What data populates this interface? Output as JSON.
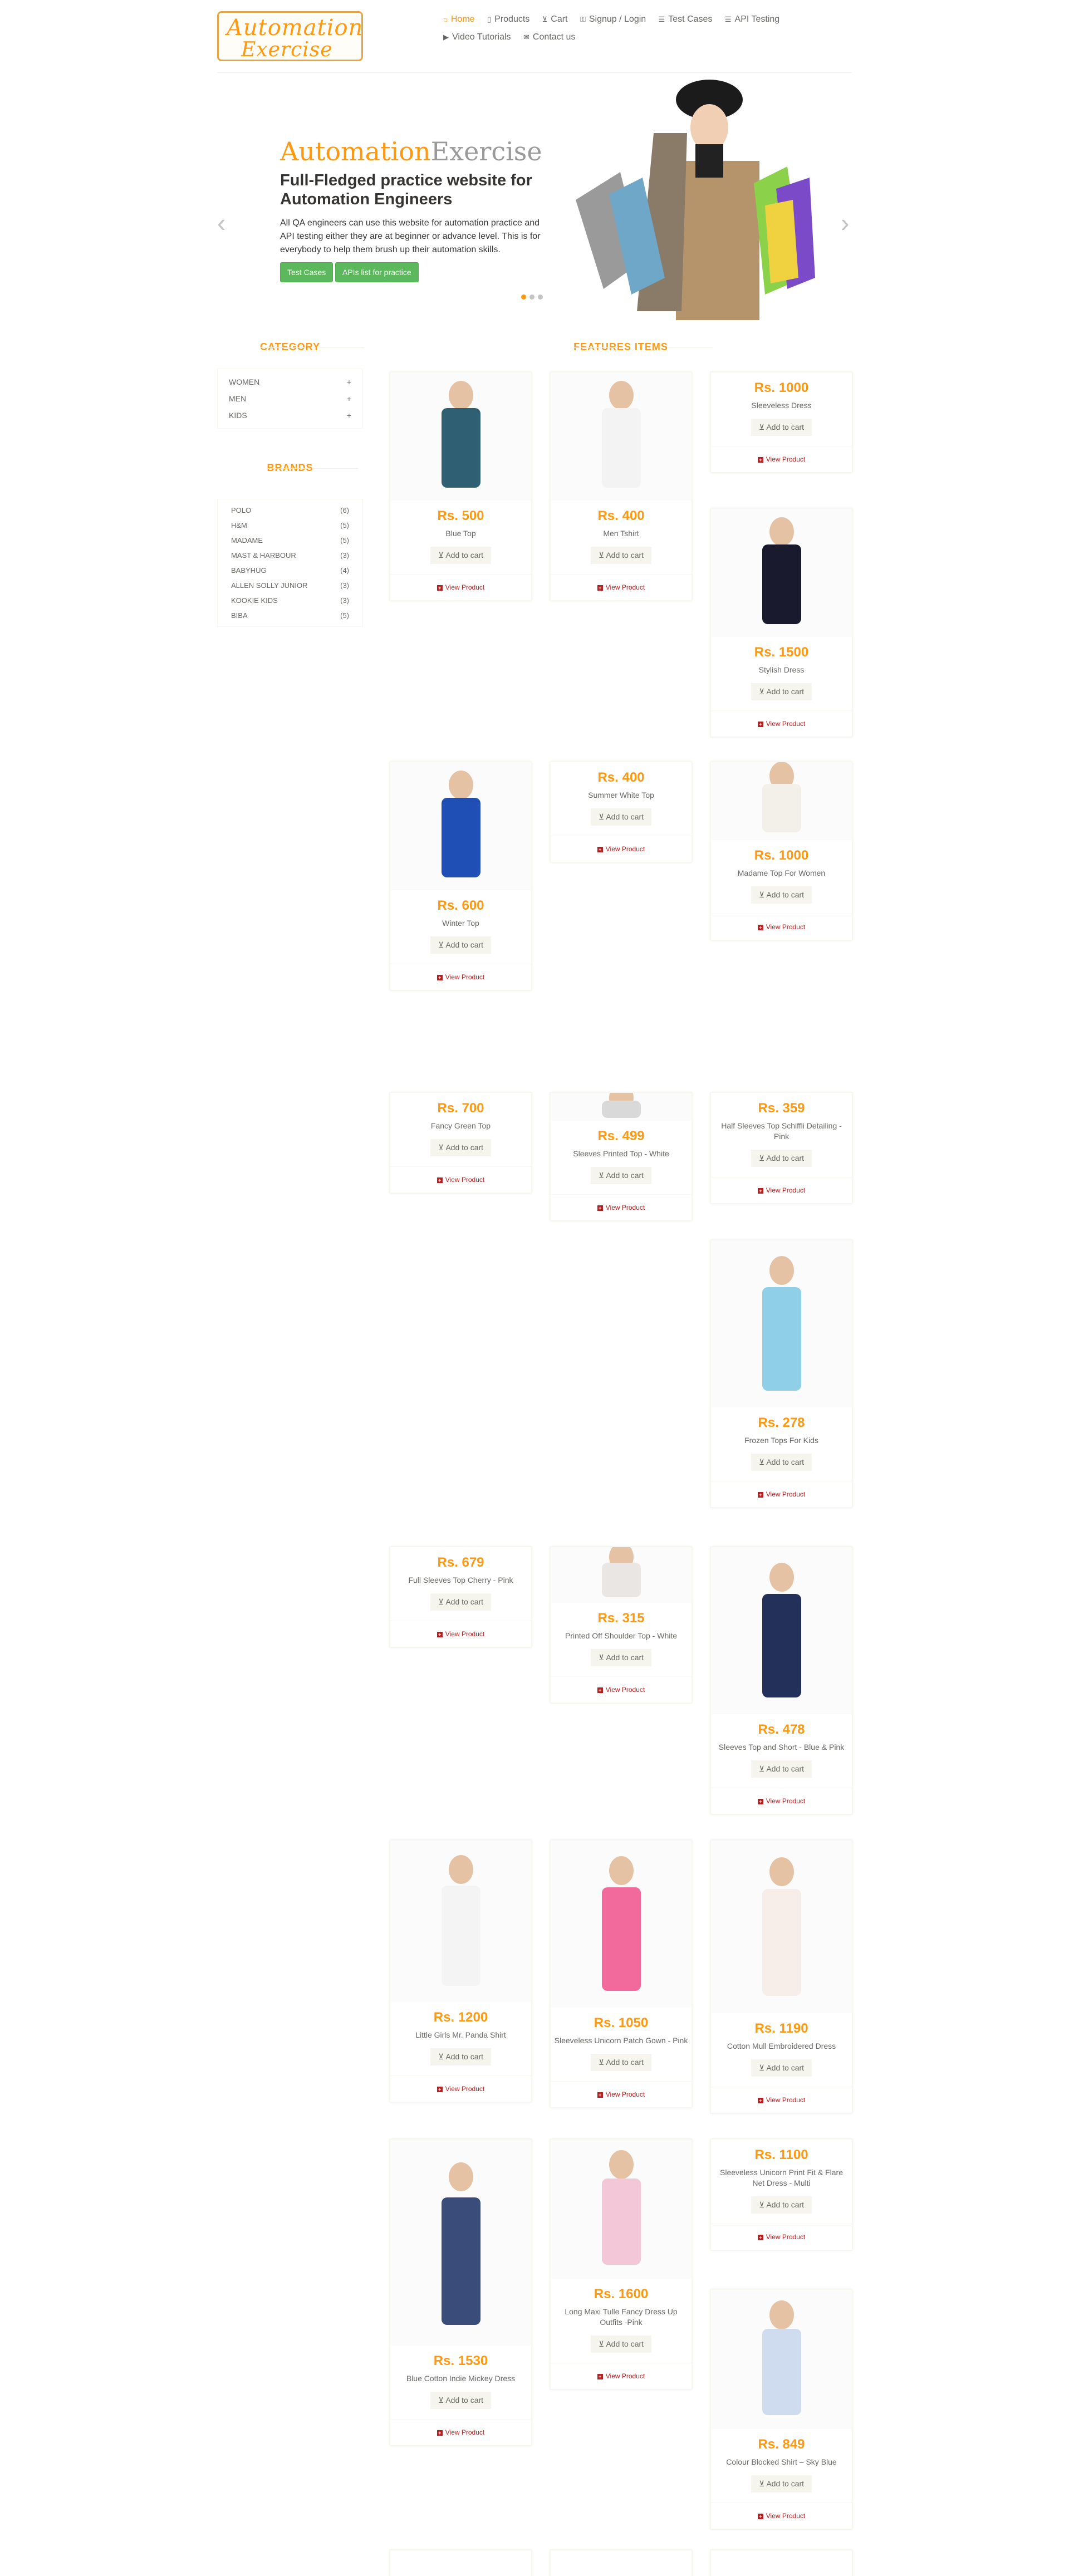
{
  "logo": {
    "part1": "Automation",
    "part2": "Exercise"
  },
  "nav": [
    {
      "label": "Home",
      "icon": "home-icon",
      "glyph": "⌂"
    },
    {
      "label": "Products",
      "icon": "products-icon",
      "glyph": "▯"
    },
    {
      "label": "Cart",
      "icon": "cart-icon",
      "glyph": "⊻"
    },
    {
      "label": "Signup / Login",
      "icon": "lock-icon",
      "glyph": "⚿"
    },
    {
      "label": "Test Cases",
      "icon": "list-icon",
      "glyph": "☰"
    },
    {
      "label": "API Testing",
      "icon": "list-icon",
      "glyph": "☰"
    },
    {
      "label": "Video Tutorials",
      "icon": "youtube-icon",
      "glyph": "▶"
    },
    {
      "label": "Contact us",
      "icon": "envelope-icon",
      "glyph": "✉"
    }
  ],
  "slider": {
    "title_a": "Automation",
    "title_b": "Exercise",
    "subtitle": "Full-Fledged practice website for Automation Engineers",
    "text": "All QA engineers can use this website for automation practice and API testing either they are at beginner or advance level. This is for everybody to help them brush up their automation skills.",
    "btn1": "Test Cases",
    "btn2": "APIs list for practice"
  },
  "sidebar": {
    "category_title": "CATEGORY",
    "categories": [
      "Women",
      "Men",
      "Kids"
    ],
    "brands_title": "BRANDS",
    "brands": [
      {
        "name": "Polo",
        "count": "(6)"
      },
      {
        "name": "H&M",
        "count": "(5)"
      },
      {
        "name": "Madame",
        "count": "(5)"
      },
      {
        "name": "Mast & Harbour",
        "count": "(3)"
      },
      {
        "name": "Babyhug",
        "count": "(4)"
      },
      {
        "name": "Allen Solly Junior",
        "count": "(3)"
      },
      {
        "name": "Kookie Kids",
        "count": "(3)"
      },
      {
        "name": "Biba",
        "count": "(5)"
      }
    ]
  },
  "features_title": "FEATURES ITEMS",
  "cart_label": "Add to cart",
  "view_label": "View Product",
  "products": [
    {
      "price": "Rs. 500",
      "name": "Blue Top"
    },
    {
      "price": "Rs. 400",
      "name": "Men Tshirt"
    },
    {
      "price": "Rs. 1000",
      "name": "Sleeveless Dress"
    },
    {
      "price": "Rs. 1500",
      "name": "Stylish Dress"
    },
    {
      "price": "Rs. 600",
      "name": "Winter Top"
    },
    {
      "price": "Rs. 400",
      "name": "Summer White Top"
    },
    {
      "price": "Rs. 1000",
      "name": "Madame Top For Women"
    },
    {
      "price": "Rs. 700",
      "name": "Fancy Green Top"
    },
    {
      "price": "Rs. 359",
      "name": "Half Sleeves Top Schiffli Detailing - Pink"
    },
    {
      "price": "Rs. 499",
      "name": "Sleeves Printed Top - White"
    },
    {
      "price": "Rs. 278",
      "name": "Frozen Tops For Kids"
    },
    {
      "price": "Rs. 679",
      "name": "Full Sleeves Top Cherry - Pink"
    },
    {
      "price": "Rs. 315",
      "name": "Printed Off Shoulder Top - White"
    },
    {
      "price": "Rs. 478",
      "name": "Sleeves Top and Short - Blue & Pink"
    },
    {
      "price": "Rs. 1200",
      "name": "Little Girls Mr. Panda Shirt"
    },
    {
      "price": "Rs. 1050",
      "name": "Sleeveless Unicorn Patch Gown - Pink"
    },
    {
      "price": "Rs. 1190",
      "name": "Cotton Mull Embroidered Dress"
    },
    {
      "price": "Rs. 1100",
      "name": "Sleeveless Unicorn Print Fit & Flare Net Dress - Multi"
    },
    {
      "price": "Rs. 1530",
      "name": "Blue Cotton Indie Mickey Dress"
    },
    {
      "price": "Rs. 1600",
      "name": "Long Maxi Tulle Fancy Dress Up Outfits -Pink"
    },
    {
      "price": "Rs. 849",
      "name": "Colour Blocked Shirt – Sky Blue"
    }
  ],
  "colors": {
    "accent": "#FE980F",
    "green": "#5CB85C",
    "link": "#B22222"
  }
}
